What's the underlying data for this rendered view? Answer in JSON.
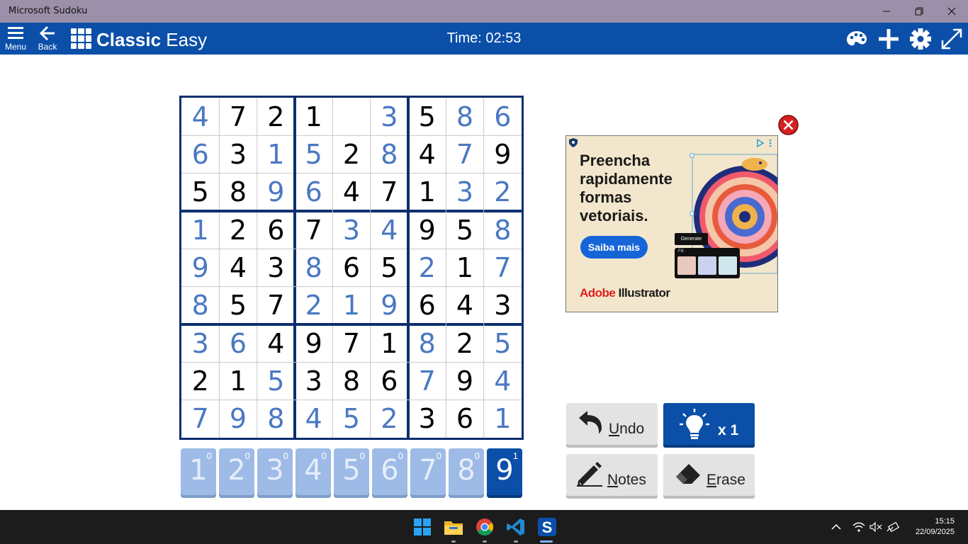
{
  "window": {
    "title": "Microsoft Sudoku",
    "minimize": "—",
    "restore": "❐",
    "close": "✕"
  },
  "appbar": {
    "menu_label": "Menu",
    "back_label": "Back",
    "title_bold": "Classic",
    "title_rest": " Easy",
    "timer": "Time: 02:53",
    "icons": [
      "palette-icon",
      "plus-icon",
      "gear-icon",
      "fullscreen-icon"
    ]
  },
  "board": {
    "values": [
      [
        4,
        7,
        2,
        1,
        0,
        3,
        5,
        8,
        6
      ],
      [
        6,
        3,
        1,
        5,
        2,
        8,
        4,
        7,
        9
      ],
      [
        5,
        8,
        9,
        6,
        4,
        7,
        1,
        3,
        2
      ],
      [
        1,
        2,
        6,
        7,
        3,
        4,
        9,
        5,
        8
      ],
      [
        9,
        4,
        3,
        8,
        6,
        5,
        2,
        1,
        7
      ],
      [
        8,
        5,
        7,
        2,
        1,
        9,
        6,
        4,
        3
      ],
      [
        3,
        6,
        4,
        9,
        7,
        1,
        8,
        2,
        5
      ],
      [
        2,
        1,
        5,
        3,
        8,
        6,
        7,
        9,
        4
      ],
      [
        7,
        9,
        8,
        4,
        5,
        2,
        3,
        6,
        1
      ]
    ],
    "given": [
      [
        0,
        1,
        1,
        1,
        0,
        0,
        1,
        0,
        0
      ],
      [
        0,
        1,
        0,
        0,
        1,
        0,
        1,
        0,
        1
      ],
      [
        1,
        1,
        0,
        0,
        1,
        1,
        1,
        0,
        0
      ],
      [
        0,
        1,
        1,
        1,
        0,
        0,
        1,
        1,
        0
      ],
      [
        0,
        1,
        1,
        0,
        1,
        1,
        0,
        1,
        0
      ],
      [
        0,
        1,
        1,
        0,
        0,
        0,
        1,
        1,
        1
      ],
      [
        0,
        0,
        1,
        1,
        1,
        1,
        0,
        1,
        0
      ],
      [
        1,
        1,
        0,
        1,
        1,
        1,
        0,
        1,
        0
      ],
      [
        0,
        0,
        0,
        0,
        0,
        0,
        1,
        1,
        0
      ]
    ],
    "given_color": "#000000",
    "user_color": "#4a78c2",
    "border_color": "#0d2f6e"
  },
  "numpad": [
    {
      "num": "1",
      "count": "0"
    },
    {
      "num": "2",
      "count": "0"
    },
    {
      "num": "3",
      "count": "0"
    },
    {
      "num": "4",
      "count": "0"
    },
    {
      "num": "5",
      "count": "0"
    },
    {
      "num": "6",
      "count": "0"
    },
    {
      "num": "7",
      "count": "0"
    },
    {
      "num": "8",
      "count": "0"
    },
    {
      "num": "9",
      "count": "1",
      "selected": true
    }
  ],
  "actions": {
    "undo_first": "U",
    "undo_rest": "ndo",
    "hint_count": "x 1",
    "notes_first": "N",
    "notes_rest": "otes",
    "erase_first": "E",
    "erase_rest": "rase"
  },
  "ad": {
    "headline": "Preencha rapidamente formas vetoriais.",
    "cta": "Saiba mais",
    "brand_a": "Adobe",
    "brand_b": " Illustrator",
    "generate": "Generate",
    "fill": "Fill"
  },
  "taskbar": {
    "apps": [
      "windows-start-icon",
      "file-explorer-icon",
      "chrome-icon",
      "vscode-icon",
      "sudoku-app-icon"
    ],
    "time": "15:15",
    "date": "22/09/2025"
  }
}
